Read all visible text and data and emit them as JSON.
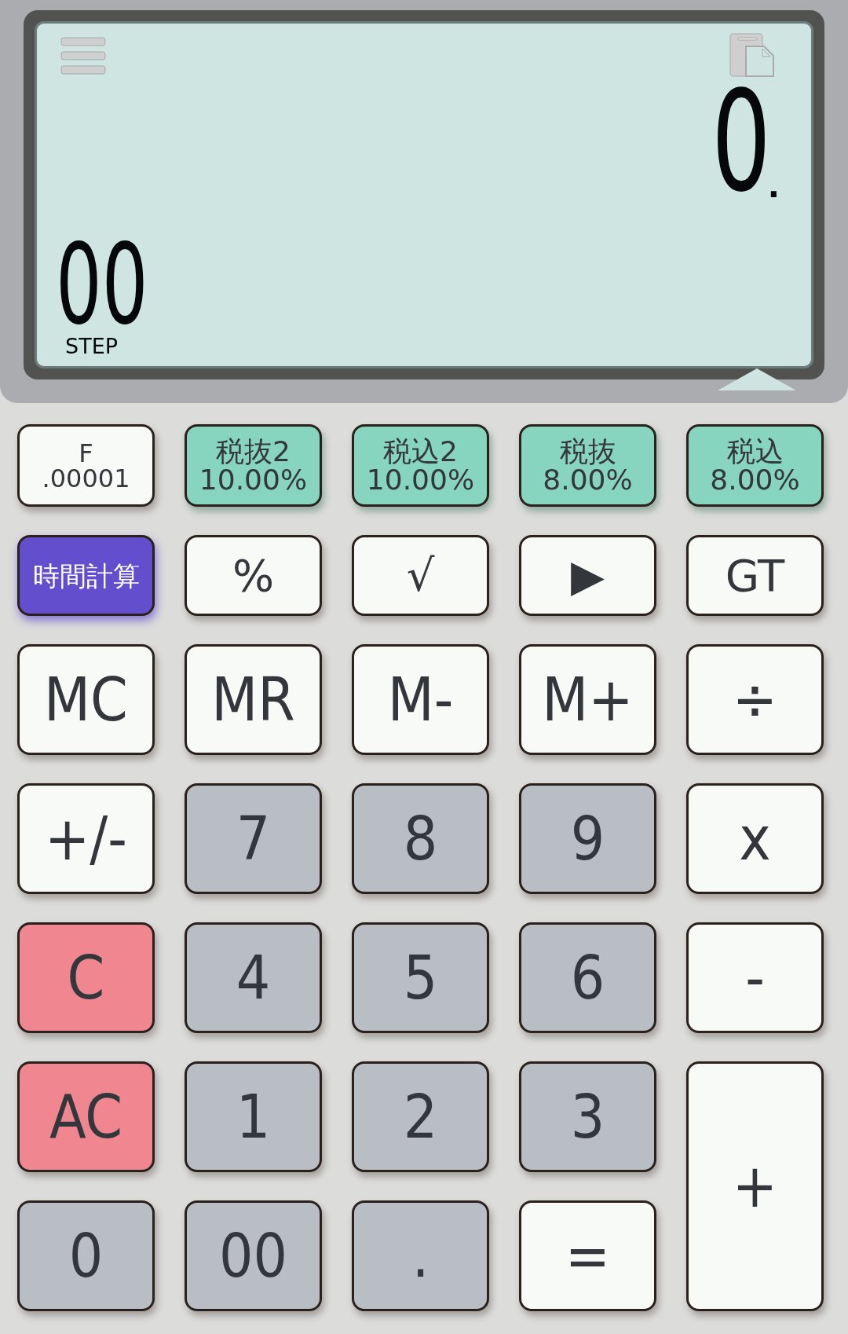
{
  "display": {
    "value": "0",
    "decimal_point": ".",
    "step": "00",
    "step_label": "STEP"
  },
  "keys": [
    {
      "kind": "function",
      "lines": [
        "F",
        ".00001"
      ],
      "tall": false
    },
    {
      "kind": "tax",
      "lines": [
        "税抜2",
        "10.00%"
      ],
      "tall": false
    },
    {
      "kind": "tax",
      "lines": [
        "税込2",
        "10.00%"
      ],
      "tall": false
    },
    {
      "kind": "tax",
      "lines": [
        "税抜",
        "8.00%"
      ],
      "tall": false
    },
    {
      "kind": "tax",
      "lines": [
        "税込",
        "8.00%"
      ],
      "tall": false
    },
    {
      "kind": "time",
      "lines": [
        "時間計算"
      ],
      "tall": false
    },
    {
      "kind": "function",
      "lines": [
        "%"
      ],
      "tall": false
    },
    {
      "kind": "function",
      "lines": [
        "√"
      ],
      "tall": false
    },
    {
      "kind": "function",
      "lines": [
        "▶"
      ],
      "tall": false
    },
    {
      "kind": "function",
      "lines": [
        "GT"
      ],
      "tall": false
    },
    {
      "kind": "memory",
      "lines": [
        "MC"
      ],
      "tall": false
    },
    {
      "kind": "memory",
      "lines": [
        "MR"
      ],
      "tall": false
    },
    {
      "kind": "memory",
      "lines": [
        "M-"
      ],
      "tall": false
    },
    {
      "kind": "memory",
      "lines": [
        "M+"
      ],
      "tall": false
    },
    {
      "kind": "operator",
      "lines": [
        "÷"
      ],
      "tall": false
    },
    {
      "kind": "operator",
      "lines": [
        "+/-"
      ],
      "tall": false
    },
    {
      "kind": "digit",
      "lines": [
        "7"
      ],
      "tall": false
    },
    {
      "kind": "digit",
      "lines": [
        "8"
      ],
      "tall": false
    },
    {
      "kind": "digit",
      "lines": [
        "9"
      ],
      "tall": false
    },
    {
      "kind": "operator",
      "lines": [
        "x"
      ],
      "tall": false
    },
    {
      "kind": "clear",
      "lines": [
        "C"
      ],
      "tall": false
    },
    {
      "kind": "digit",
      "lines": [
        "4"
      ],
      "tall": false
    },
    {
      "kind": "digit",
      "lines": [
        "5"
      ],
      "tall": false
    },
    {
      "kind": "digit",
      "lines": [
        "6"
      ],
      "tall": false
    },
    {
      "kind": "operator",
      "lines": [
        "-"
      ],
      "tall": false
    },
    {
      "kind": "clear",
      "lines": [
        "AC"
      ],
      "tall": false
    },
    {
      "kind": "digit",
      "lines": [
        "1"
      ],
      "tall": false
    },
    {
      "kind": "digit",
      "lines": [
        "2"
      ],
      "tall": false
    },
    {
      "kind": "digit",
      "lines": [
        "3"
      ],
      "tall": false
    },
    {
      "kind": "operator",
      "lines": [
        "+"
      ],
      "tall": true
    },
    {
      "kind": "digit",
      "lines": [
        "0"
      ],
      "tall": false
    },
    {
      "kind": "digit",
      "lines": [
        "00"
      ],
      "tall": false
    },
    {
      "kind": "digit",
      "lines": [
        "."
      ],
      "tall": false
    },
    {
      "kind": "operator",
      "lines": [
        "="
      ],
      "tall": false
    }
  ]
}
